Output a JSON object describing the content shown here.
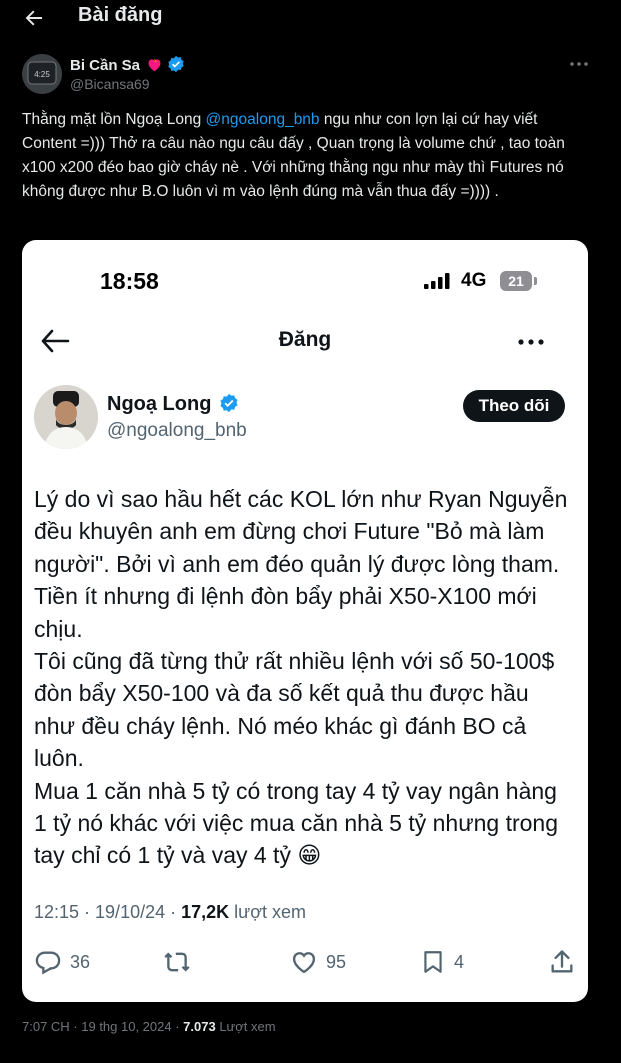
{
  "header": {
    "title": "Bài đăng",
    "back_icon": "arrow-left-icon"
  },
  "author": {
    "name": "Bi Cần Sa",
    "handle": "@Bicansa69",
    "avatar_text": "4:25",
    "badges": [
      "fire-heart-icon",
      "verified-badge-icon"
    ],
    "verified_color": "#1d9bf0"
  },
  "tweet": {
    "text_part1": "Thằng mặt lồn Ngoạ Long ",
    "mention": "@ngoalong_bnb",
    "text_part2": " ngu như con lợn lại cứ hay viết Content =))) Thở ra câu nào ngu câu đấy , Quan trọng là volume chứ , tao toàn x100 x200 đéo bao giờ cháy nè . Với những thằng ngu như mày thì Futures nó không được như B.O luôn vì m vào lệnh đúng mà vẫn thua đấy =)))) ."
  },
  "screenshot": {
    "status_time": "18:58",
    "network": "4G",
    "battery": "21",
    "nav_title": "Đăng",
    "name": "Ngoạ Long",
    "handle": "@ngoalong_bnb",
    "follow_label": "Theo dõi",
    "body": [
      "Lý do vì sao hầu hết các KOL lớn như Ryan Nguyễn đều khuyên anh em đừng chơi Future \"Bỏ mà làm người\". Bởi vì anh em đéo quản lý được lòng tham. Tiền ít nhưng đi lệnh đòn bẩy phải X50-X100 mới chịu.",
      "Tôi cũng đã từng thử rất nhiều lệnh với số 50-100$ đòn bẩy X50-100 và đa số kết quả thu được hầu như đều cháy lệnh. Nó méo khác gì đánh BO cả luôn.",
      "Mua 1 căn nhà 5 tỷ có trong tay 4 tỷ vay ngân hàng 1 tỷ nó khác với việc mua căn nhà 5 tỷ nhưng trong tay chỉ có 1 tỷ và vay 4 tỷ 😁"
    ],
    "meta_time": "12:15 · 19/10/24 · ",
    "views": "17,2K",
    "views_label": " lượt xem",
    "replies": "36",
    "retweets": "",
    "likes": "95",
    "bookmarks": "4"
  },
  "footer": {
    "time": "7:07 CH · 19 thg 10, 2024 · ",
    "views": "7.073",
    "views_label": " Lượt xem"
  }
}
